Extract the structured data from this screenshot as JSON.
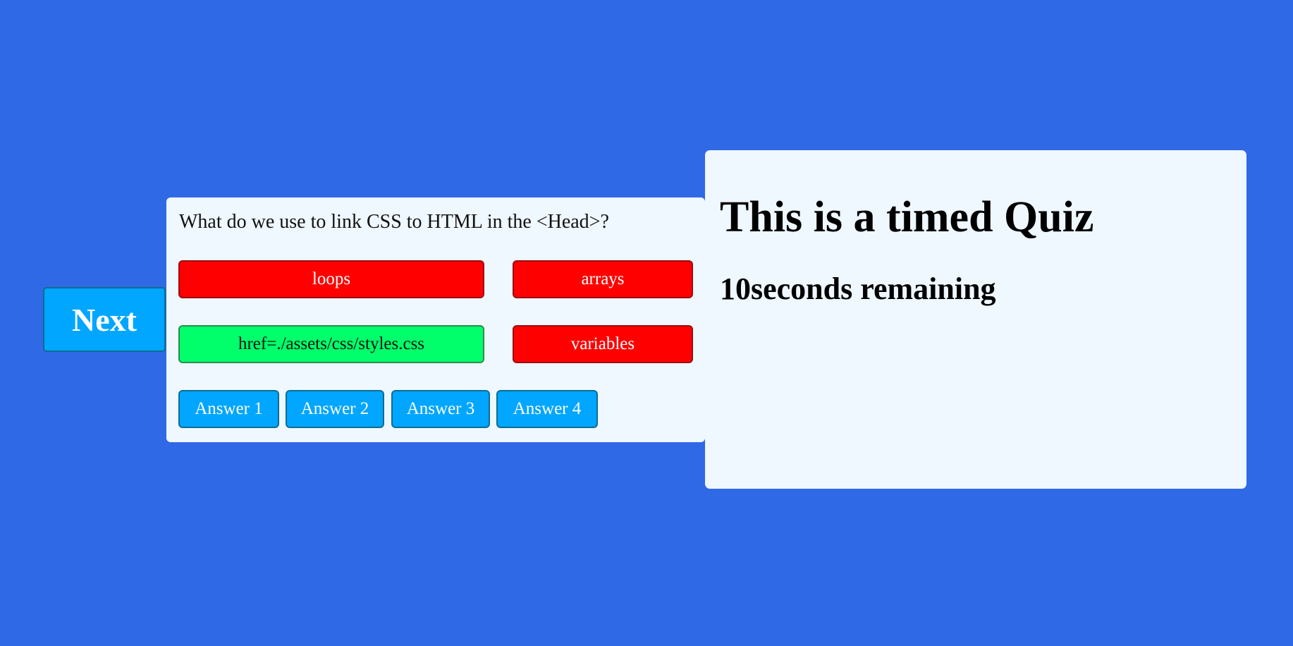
{
  "controls": {
    "next_label": "Next"
  },
  "quiz": {
    "question": "What do we use to link CSS to HTML in the <Head>?",
    "choices": [
      {
        "label": "loops",
        "status": "incorrect"
      },
      {
        "label": "arrays",
        "status": "incorrect"
      },
      {
        "label": "href=./assets/css/styles.css",
        "status": "correct"
      },
      {
        "label": "variables",
        "status": "incorrect"
      }
    ],
    "answer_buttons": [
      "Answer 1",
      "Answer 2",
      "Answer 3",
      "Answer 4"
    ]
  },
  "timer": {
    "title": "This is a timed Quiz",
    "remaining": "10seconds remaining"
  },
  "colors": {
    "page_background": "#3069e6",
    "card_background": "#eff7ff",
    "button_blue": "#00a6ff",
    "correct_green": "#00ff6a",
    "incorrect_red": "#ff0000"
  }
}
